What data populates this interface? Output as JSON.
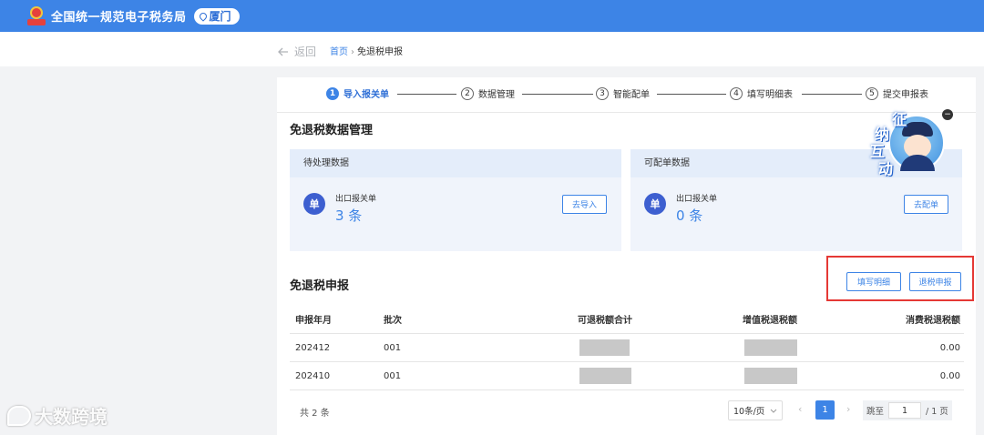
{
  "header": {
    "title": "全国统一规范电子税务局",
    "region": "厦门",
    "brand_color": "#3d84e6"
  },
  "breadcrumb": {
    "back": "返回",
    "home": "首页",
    "separator": "›",
    "current": "免退税申报"
  },
  "steps": [
    {
      "num": "1",
      "label": "导入报关单",
      "active": true
    },
    {
      "num": "2",
      "label": "数据管理",
      "active": false
    },
    {
      "num": "3",
      "label": "智能配单",
      "active": false
    },
    {
      "num": "4",
      "label": "填写明细表",
      "active": false
    },
    {
      "num": "5",
      "label": "提交申报表",
      "active": false
    }
  ],
  "data_mgmt": {
    "title": "免退税数据管理",
    "pending": {
      "header": "待处理数据",
      "label": "出口报关单",
      "count": "3 条",
      "button": "去导入"
    },
    "matchable": {
      "header": "可配单数据",
      "label": "出口报关单",
      "count": "0 条",
      "button": "去配单"
    }
  },
  "declaration": {
    "title": "免退税申报",
    "fill_button": "填写明细",
    "submit_button": "退税申报",
    "columns": [
      "申报年月",
      "批次",
      "可退税额合计",
      "增值税退税额",
      "消费税退税额"
    ],
    "rows": [
      {
        "period": "202412",
        "batch": "001",
        "consumption_refund": "0.00"
      },
      {
        "period": "202410",
        "batch": "001",
        "consumption_refund": "0.00"
      }
    ]
  },
  "pagination": {
    "total": "共 2 条",
    "page_size": "10条/页",
    "current_page": "1",
    "jump_label": "跳至",
    "jump_value": "1",
    "page_total": "/ 1 页"
  },
  "mascot": {
    "chars": [
      "征",
      "纳",
      "互",
      "动"
    ],
    "close": "−"
  },
  "watermark": "大数跨境"
}
